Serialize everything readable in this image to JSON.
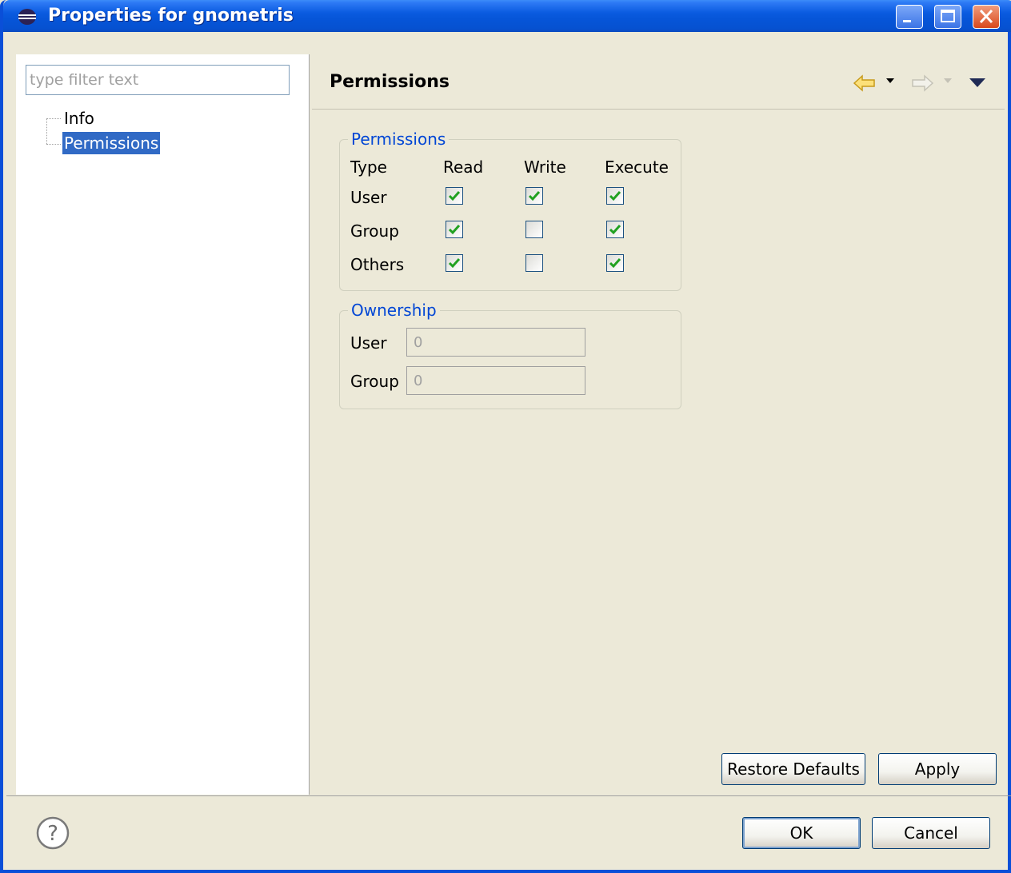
{
  "window": {
    "title": "Properties for gnometris"
  },
  "sidebar": {
    "filter_placeholder": "type filter text",
    "items": [
      {
        "label": "Info",
        "selected": false
      },
      {
        "label": "Permissions",
        "selected": true
      }
    ]
  },
  "page": {
    "title": "Permissions",
    "permissions": {
      "legend": "Permissions",
      "headers": [
        "Type",
        "Read",
        "Write",
        "Execute"
      ],
      "rows": [
        {
          "type": "User",
          "read": true,
          "write": true,
          "execute": true
        },
        {
          "type": "Group",
          "read": true,
          "write": false,
          "execute": true
        },
        {
          "type": "Others",
          "read": true,
          "write": false,
          "execute": true
        }
      ]
    },
    "ownership": {
      "legend": "Ownership",
      "user_label": "User",
      "user_value": "0",
      "group_label": "Group",
      "group_value": "0"
    },
    "buttons": {
      "restore_defaults": "Restore Defaults",
      "apply": "Apply"
    }
  },
  "dialog_buttons": {
    "ok": "OK",
    "cancel": "Cancel"
  },
  "colors": {
    "titlebar": "#0655D8",
    "selection": "#316AC5",
    "legend": "#0046D5",
    "check": "#21A121"
  }
}
